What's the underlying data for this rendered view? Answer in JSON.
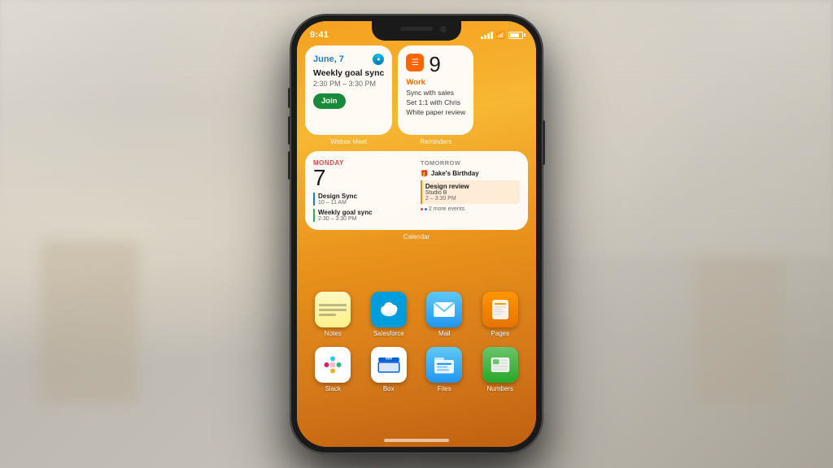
{
  "phone": {
    "status_bar": {
      "time": "9:41",
      "signal": "signal",
      "wifi": "wifi",
      "battery": "battery"
    }
  },
  "widgets": {
    "webex": {
      "label": "Webex Meet",
      "date": "June, 7",
      "event_title": "Weekly goal sync",
      "event_time": "2:30 PM – 3:30 PM",
      "join_btn": "Join"
    },
    "reminders": {
      "label": "Reminders",
      "count": "9",
      "category": "Work",
      "items": [
        "Sync with sales",
        "Set 1:1 with Chris",
        "White paper review"
      ]
    },
    "calendar": {
      "label": "Calendar",
      "day_name": "MONDAY",
      "day_num": "7",
      "tomorrow_label": "TOMORROW",
      "birthday": "Jake's Birthday",
      "events_today": [
        {
          "title": "Design Sync",
          "time": "10 – 11 AM",
          "color": "blue"
        },
        {
          "title": "Weekly goal sync",
          "time": "2:30 – 3:30 PM",
          "color": "green"
        }
      ],
      "events_tomorrow": [
        {
          "title": "Design review",
          "subtitle": "Studio B",
          "time": "2 – 3:30 PM"
        }
      ],
      "more_events": "2 more events"
    }
  },
  "apps": {
    "row1": [
      {
        "id": "notes",
        "label": "Notes"
      },
      {
        "id": "salesforce",
        "label": "Salesforce"
      },
      {
        "id": "mail",
        "label": "Mail"
      },
      {
        "id": "pages",
        "label": "Pages"
      }
    ],
    "row2": [
      {
        "id": "slack",
        "label": "Slack"
      },
      {
        "id": "box",
        "label": "Box"
      },
      {
        "id": "files",
        "label": "Files"
      },
      {
        "id": "numbers",
        "label": "Numbers"
      }
    ]
  }
}
